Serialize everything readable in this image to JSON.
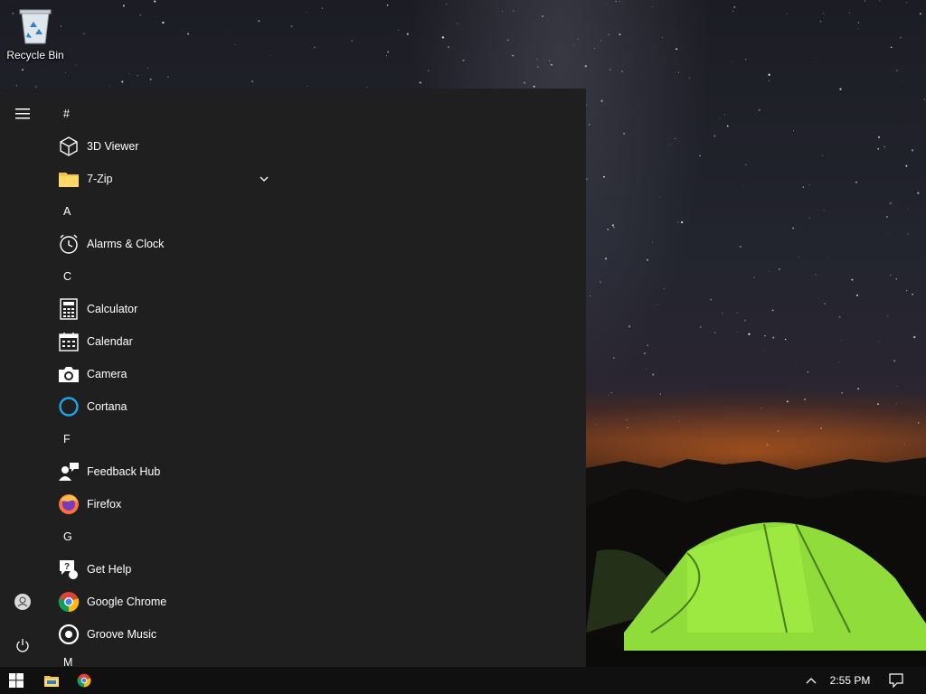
{
  "desktop": {
    "icons": [
      {
        "label": "Recycle Bin",
        "icon": "recycle-bin-icon"
      }
    ]
  },
  "start_menu": {
    "rail": {
      "menu_icon": "hamburger-menu-icon",
      "account_icon": "user-account-icon",
      "power_icon": "power-icon"
    },
    "apps": {
      "hash": "#",
      "viewer3d": "3D Viewer",
      "zip7": "7-Zip",
      "a": "A",
      "alarms": "Alarms & Clock",
      "c": "C",
      "calculator": "Calculator",
      "calendar": "Calendar",
      "camera": "Camera",
      "cortana": "Cortana",
      "f": "F",
      "feedback": "Feedback Hub",
      "firefox": "Firefox",
      "g": "G",
      "gethelp": "Get Help",
      "chrome": "Google Chrome",
      "groove": "Groove Music",
      "m": "M"
    }
  },
  "taskbar": {
    "start_icon": "windows-logo-icon",
    "pinned": [
      "file-explorer-icon",
      "chrome-icon"
    ],
    "tray_icon": "chevron-up-icon",
    "clock": "2:55 PM",
    "action_center_icon": "notification-icon"
  },
  "colors": {
    "start_bg": "#1f1f1f",
    "taskbar_bg": "#101010",
    "accent_cortana": "#1fa3e8",
    "tent_green": "#8fdc3a"
  }
}
